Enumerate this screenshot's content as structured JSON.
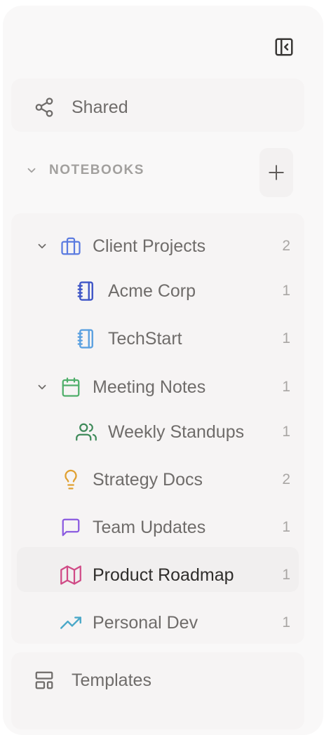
{
  "sidebar": {
    "collapse_icon": "sidebar-collapse-icon",
    "shared": {
      "label": "Shared",
      "icon": "share-icon"
    },
    "notebooks_header": {
      "label": "NOTEBOOKS",
      "add_icon": "plus-icon"
    },
    "notebooks": [
      {
        "label": "Client Projects",
        "count": "2",
        "icon": "briefcase-icon",
        "color": "#5b7be0",
        "expanded": true
      },
      {
        "label": "Acme Corp",
        "count": "1",
        "icon": "notebook-icon",
        "color": "#3e55c6"
      },
      {
        "label": "TechStart",
        "count": "1",
        "icon": "notebook-icon",
        "color": "#5aa0e0"
      },
      {
        "label": "Meeting Notes",
        "count": "1",
        "icon": "calendar-icon",
        "color": "#4fae6a",
        "expanded": true
      },
      {
        "label": "Weekly Standups",
        "count": "1",
        "icon": "users-icon",
        "color": "#3f8a5a"
      },
      {
        "label": "Strategy Docs",
        "count": "2",
        "icon": "lightbulb-icon",
        "color": "#e0a030"
      },
      {
        "label": "Team Updates",
        "count": "1",
        "icon": "message-icon",
        "color": "#8a5ae0"
      },
      {
        "label": "Product Roadmap",
        "count": "1",
        "icon": "map-icon",
        "color": "#d04a86",
        "active": true
      },
      {
        "label": "Personal Dev",
        "count": "1",
        "icon": "trending-up-icon",
        "color": "#4aa8c8"
      }
    ],
    "templates": {
      "label": "Templates",
      "icon": "layout-template-icon"
    }
  }
}
